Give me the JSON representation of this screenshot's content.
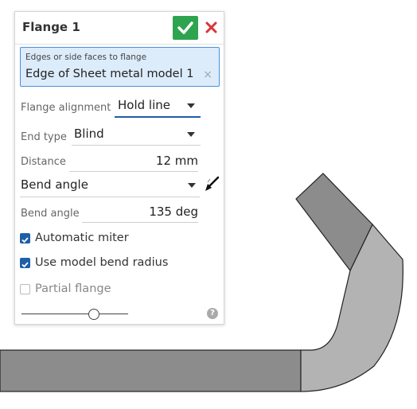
{
  "dialog": {
    "title": "Flange 1",
    "selection": {
      "label": "Edges or side faces to flange",
      "value": "Edge of Sheet metal model 1",
      "clear": "×"
    },
    "flange_alignment": {
      "label": "Flange alignment",
      "value": "Hold line"
    },
    "end_type": {
      "label": "End type",
      "value": "Blind"
    },
    "distance": {
      "label": "Distance",
      "value": "12 mm"
    },
    "angle_mode": {
      "value": "Bend angle"
    },
    "bend_angle": {
      "label": "Bend angle",
      "value": "135 deg"
    },
    "options": [
      {
        "label": "Automatic miter",
        "checked": true
      },
      {
        "label": "Use model bend radius",
        "checked": true
      },
      {
        "label": "Partial flange",
        "checked": false
      }
    ],
    "slider": {
      "level": 0.68
    },
    "help": "?"
  },
  "colors": {
    "accent": "#1f5fa8",
    "ok": "#2ea44f",
    "close": "#d9343a",
    "selection_bg": "#dcecfb",
    "model_face": "#8c8c8c",
    "model_bend": "#b3b3b3"
  },
  "icons": [
    "check-icon",
    "close-icon",
    "opposite-direction-icon",
    "chevron-down-icon",
    "help-icon"
  ]
}
